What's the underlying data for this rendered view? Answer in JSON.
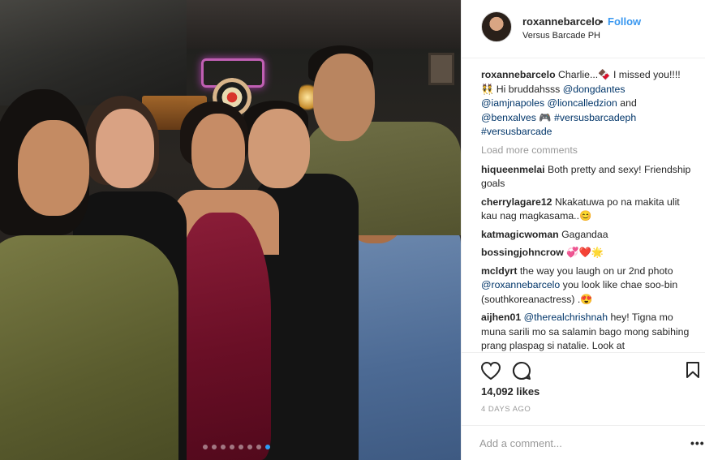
{
  "post": {
    "username": "roxannebarcelo",
    "separator": "•",
    "follow_label": "Follow",
    "location": "Versus Barcade PH"
  },
  "caption": {
    "username": "roxannebarcelo",
    "line1": "Charlie...",
    "emoji1": "🍫",
    "line1b": " I missed you!!!!",
    "emoji2": "👯",
    "line2": " Hi bruddahsss ",
    "tag1": "@dongdantes",
    "tag2": "@iamjnapoles",
    "tag3": "@lioncalledzion",
    "and": " and",
    "tag4": "@benxalves",
    "emoji3": "🎮",
    "hashtag1": "#versusbarcadeph",
    "hashtag2": "#versusbarcade"
  },
  "load_more": "Load more comments",
  "comments": [
    {
      "user": "hiqueenmelai",
      "text": "Both pretty and sexy! Friendship goals"
    },
    {
      "user": "cherrylagare12",
      "text": "Nkakatuwa po na makita ulit kau nag magkasama..",
      "emoji": "😊"
    },
    {
      "user": "katmagicwoman",
      "text": "Gagandaa"
    },
    {
      "user": "bossingjohncrow",
      "text": "",
      "emoji": "💞❤️🌟"
    },
    {
      "user": "mcldyrt",
      "text_a": "the way you laugh on ur 2nd photo ",
      "tag": "@roxannebarcelo",
      "text_b": " you look like chae soo-bin (southkoreanactress) .",
      "emoji": "😍"
    },
    {
      "user": "aijhen01",
      "tag": "@therealchrishnah",
      "text": " hey! Tigna mo muna sarili mo sa salamin bago mong sabihing prang plaspag si natalie. Look at"
    }
  ],
  "actions": {
    "like_icon": "heart-icon",
    "comment_icon": "comment-icon",
    "save_icon": "bookmark-icon"
  },
  "likes": "14,092 likes",
  "timestamp": "4 DAYS AGO",
  "add_comment_placeholder": "Add a comment...",
  "more_options": "•••",
  "carousel": {
    "count": 8,
    "active_index": 7
  },
  "colors": {
    "link": "#003569",
    "follow": "#3897f0",
    "muted": "#999999",
    "text": "#262626"
  }
}
